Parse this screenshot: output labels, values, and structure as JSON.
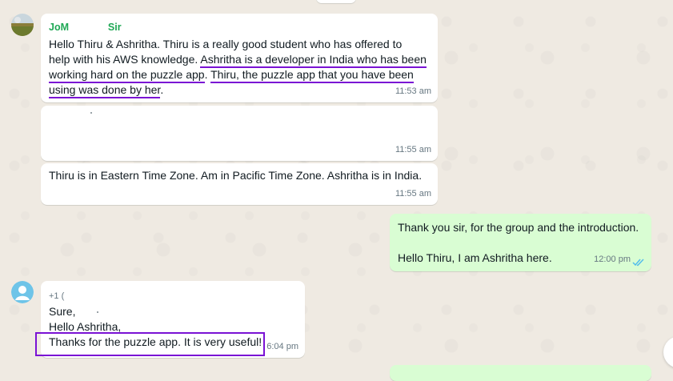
{
  "messages": [
    {
      "sender": "JoM",
      "sender_extra": "Sir",
      "text_lines": [
        "Hello Thiru & Ashritha. Thiru is a really good student who has offered to",
        "help with his AWS knowledge. ",
        "Ashritha is a developer in India who has been",
        "working hard on the puzzle app",
        ". ",
        "Thiru, the puzzle app that you have been",
        "using was done by her",
        "."
      ],
      "time": "11:53 am"
    },
    {
      "time": "11:55 am"
    },
    {
      "text": "Thiru is in Eastern Time Zone. Am in Pacific Time Zone. Ashritha is in India.",
      "time": "11:55 am"
    },
    {
      "text_1": "Thank you sir, for the group and the introduction.",
      "text_2": "Hello Thiru, I am Ashritha  here.",
      "time": "12:00 pm"
    },
    {
      "sender": "+1 (",
      "line_1": "Sure,",
      "line_2": "Hello Ashritha,",
      "line_3": "Thanks for the puzzle app. It is very useful!",
      "time": "6:04 pm"
    }
  ],
  "colors": {
    "wallpaper": "#efeae2",
    "incoming": "#ffffff",
    "outgoing": "#d9fdd3",
    "sender_name": "#1fa855",
    "annotation": "#7a12d4",
    "read_ticks": "#53bdeb"
  },
  "icons": [
    "avatar-photo",
    "default-avatar-icon",
    "double-check-icon"
  ]
}
